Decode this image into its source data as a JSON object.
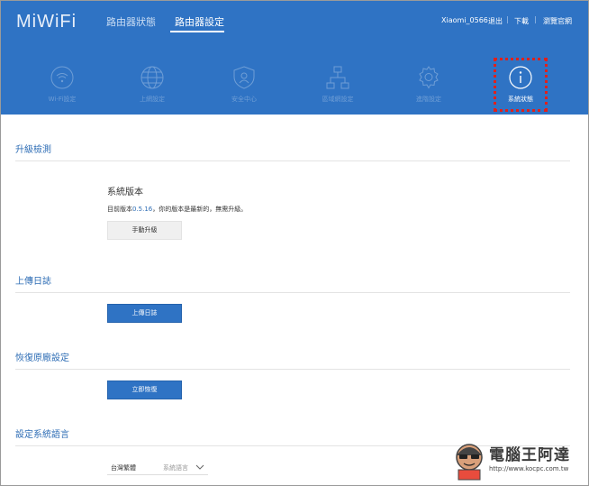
{
  "header": {
    "logo": "MiWiFi",
    "tabs": [
      {
        "label": "路由器狀態"
      },
      {
        "label": "路由器設定"
      }
    ],
    "user": "Xiaomi_0566",
    "links": [
      "退出",
      "下載",
      "瀏覽官網"
    ],
    "separator": "|"
  },
  "nav": [
    {
      "label": "Wi-Fi設定",
      "icon": "wifi-icon"
    },
    {
      "label": "上網設定",
      "icon": "globe-icon"
    },
    {
      "label": "安全中心",
      "icon": "shield-icon"
    },
    {
      "label": "區域網設定",
      "icon": "network-icon"
    },
    {
      "label": "進階設定",
      "icon": "gear-icon"
    },
    {
      "label": "系統狀態",
      "icon": "info-icon",
      "active": true
    }
  ],
  "sections": {
    "upgrade": {
      "title": "升級檢測",
      "subtitle": "系統版本",
      "text_prefix": "目前版本",
      "version": "0.5.16",
      "text_suffix": "，你的版本是最新的，無需升級。",
      "button": "手動升級"
    },
    "upload_log": {
      "title": "上傳日誌",
      "button": "上傳日誌"
    },
    "restore": {
      "title": "恢復原廠設定",
      "button": "立即恢復"
    },
    "language": {
      "title": "設定系統語言",
      "selected": "台灣繁體",
      "placeholder": "系統語言"
    }
  },
  "watermark": {
    "title": "電腦王阿達",
    "url": "http://www.kocpc.com.tw"
  },
  "colors": {
    "header_bg": "#2f73c4",
    "accent": "#2e6db5",
    "highlight": "#e0201b"
  }
}
